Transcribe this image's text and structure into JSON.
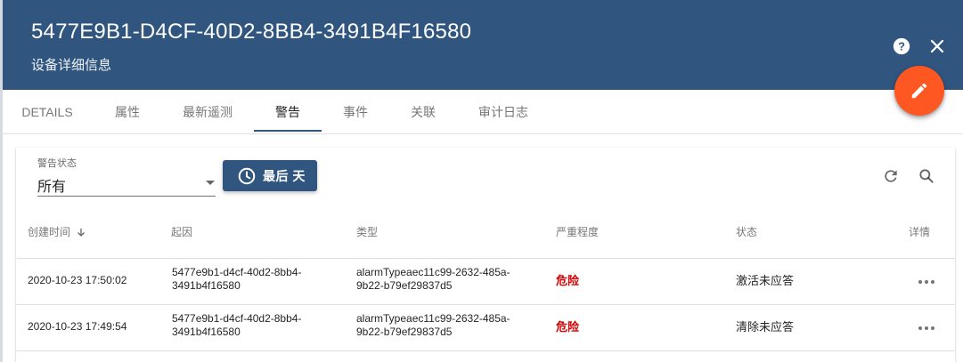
{
  "header": {
    "title": "5477E9B1-D4CF-40D2-8BB4-3491B4F16580",
    "subtitle": "设备详细信息",
    "icons": {
      "help": "help-icon",
      "close": "close-icon",
      "edit": "edit-pencil-icon"
    }
  },
  "tabs": [
    {
      "label": "DETAILS"
    },
    {
      "label": "属性"
    },
    {
      "label": "最新遥测"
    },
    {
      "label": "警告",
      "active": true
    },
    {
      "label": "事件"
    },
    {
      "label": "关联"
    },
    {
      "label": "审计日志"
    }
  ],
  "filters": {
    "status_label": "警告状态",
    "status_value": "所有",
    "time_button_label": "最后 天"
  },
  "table": {
    "headers": {
      "created": "创建时间",
      "originator": "起因",
      "type": "类型",
      "severity": "严重程度",
      "status": "状态",
      "details": "详情"
    },
    "sort": {
      "column": "created",
      "direction": "desc"
    },
    "rows": [
      {
        "created": "2020-10-23 17:50:02",
        "originator_line1": "5477e9b1-d4cf-40d2-8bb4-",
        "originator_line2": "3491b4f16580",
        "type_line1": "alarmTypeaec11c99-2632-485a-",
        "type_line2": "9b22-b79ef29837d5",
        "severity": "危险",
        "status": "激活未应答"
      },
      {
        "created": "2020-10-23 17:49:54",
        "originator_line1": "5477e9b1-d4cf-40d2-8bb4-",
        "originator_line2": "3491b4f16580",
        "type_line1": "alarmTypeaec11c99-2632-485a-",
        "type_line2": "9b22-b79ef29837d5",
        "severity": "危险",
        "status": "清除未应答"
      }
    ]
  },
  "colors": {
    "primary": "#305680",
    "accent": "#ff5722",
    "severity_critical": "#d50000"
  }
}
